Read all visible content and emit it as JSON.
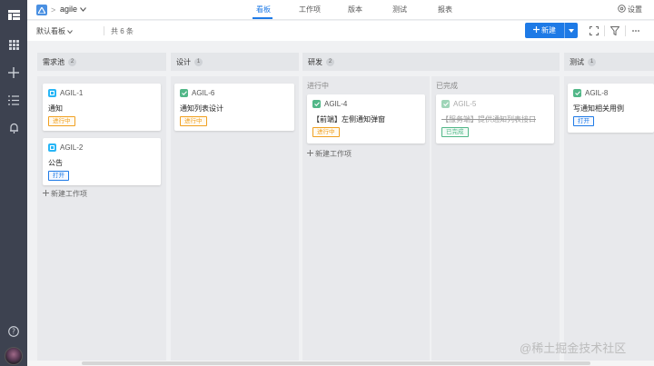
{
  "sidebar": {
    "icons": [
      "windows-icon",
      "apps-grid-icon",
      "plus-icon",
      "list-icon",
      "bell-icon",
      "help-icon"
    ]
  },
  "header": {
    "project_name": "agile",
    "tabs": [
      {
        "label": "看板",
        "active": true
      },
      {
        "label": "工作项",
        "active": false
      },
      {
        "label": "版本",
        "active": false
      },
      {
        "label": "测试",
        "active": false
      },
      {
        "label": "报表",
        "active": false
      }
    ],
    "settings_label": "设置"
  },
  "toolbar": {
    "board_name": "默认看板",
    "count_text": "共 6 条",
    "new_button_label": "新建"
  },
  "columns": {
    "backlog": {
      "name": "需求池",
      "count": "2",
      "new_item": "新建工作项"
    },
    "design": {
      "name": "设计",
      "count": "1"
    },
    "dev": {
      "name": "研发",
      "count": "2",
      "sub_in_progress": "进行中",
      "sub_done": "已完成",
      "new_item": "新建工作项"
    },
    "test": {
      "name": "测试",
      "count": "1"
    }
  },
  "cards": {
    "agile1": {
      "id": "AGIL-1",
      "title": "通知",
      "status": "进行中",
      "type": "story"
    },
    "agile2": {
      "id": "AGIL-2",
      "title": "公告",
      "status": "打开",
      "type": "story"
    },
    "agile6": {
      "id": "AGIL-6",
      "title": "通知列表设计",
      "status": "进行中",
      "type": "task"
    },
    "agile4": {
      "id": "AGIL-4",
      "title": "【前端】左侧通知弹窗",
      "status": "进行中",
      "type": "task"
    },
    "agile5": {
      "id": "AGIL-5",
      "title": "【服务端】提供通知列表接口",
      "status": "已完成",
      "type": "task"
    },
    "agile8": {
      "id": "AGIL-8",
      "title": "写通知相关用例",
      "status": "打开",
      "type": "task"
    }
  },
  "watermark": "@稀土掘金技术社区",
  "colors": {
    "primary": "#1e7ae6",
    "sidebar_bg": "#3d4250",
    "story_icon": "#29b6f6",
    "task_icon": "#52b788",
    "in_progress": "#f0a020",
    "done": "#52b788"
  }
}
